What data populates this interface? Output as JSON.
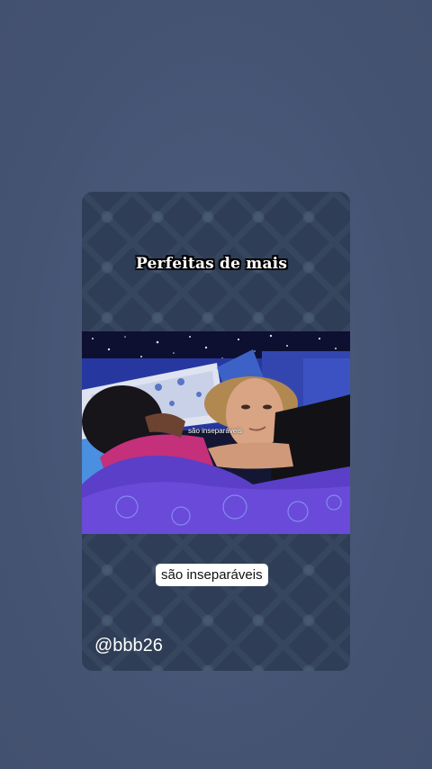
{
  "story": {
    "title_sticker": "Perfeitas de mais",
    "video_caption": "são inseparáveis",
    "label_sticker": "são inseparáveis",
    "mention": "@bbb26"
  },
  "colors": {
    "background": "#485678",
    "card": "#2f3e56",
    "blanket": "#5b3fc8",
    "headboard": "#3346b0"
  }
}
